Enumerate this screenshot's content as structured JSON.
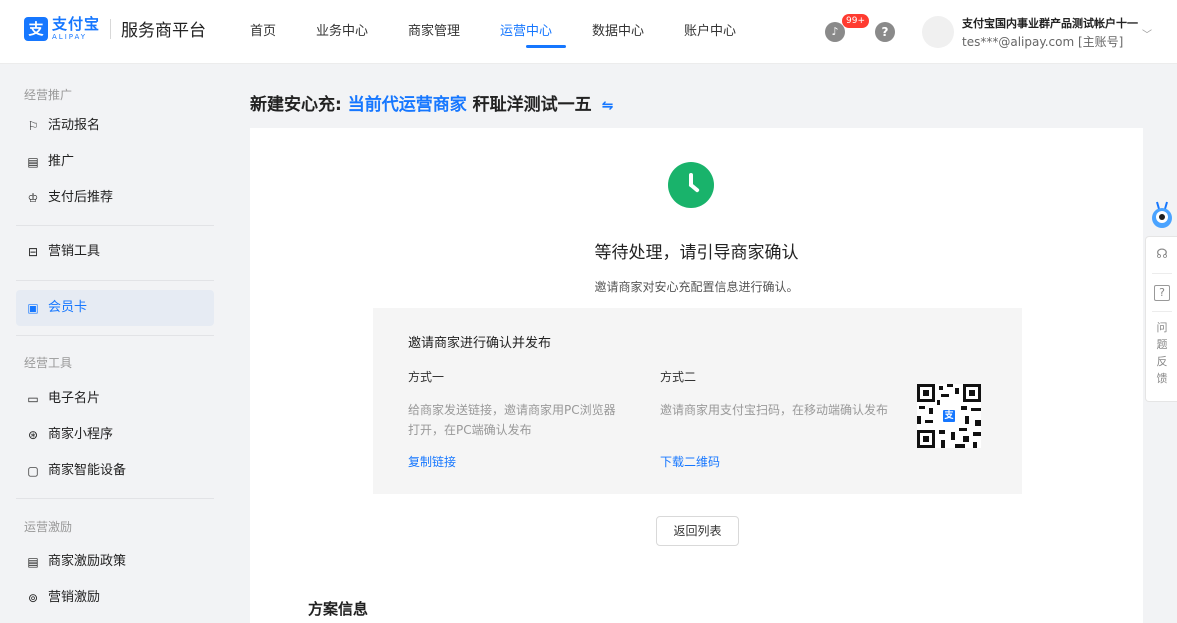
{
  "brand": {
    "logo_mark": "支",
    "name_cn": "支付宝",
    "name_en": "ALIPAY",
    "platform": "服务商平台"
  },
  "nav": [
    {
      "label": "首页",
      "active": false
    },
    {
      "label": "业务中心",
      "active": false
    },
    {
      "label": "商家管理",
      "active": false
    },
    {
      "label": "运营中心",
      "active": true
    },
    {
      "label": "数据中心",
      "active": false
    },
    {
      "label": "账户中心",
      "active": false
    }
  ],
  "header": {
    "notification_badge": "99+",
    "help_icon": "?",
    "account_name": "支付宝国内事业群产品测试帐户十一",
    "account_email": "tes***@alipay.com [主账号]"
  },
  "sidebar": {
    "groups": [
      {
        "label": "经营推广",
        "items": [
          {
            "label": "活动报名",
            "icon": "flag-icon",
            "glyph": "⚐"
          },
          {
            "label": "推广",
            "icon": "list-icon",
            "glyph": "▤"
          },
          {
            "label": "支付后推荐",
            "icon": "crown-icon",
            "glyph": "♔"
          }
        ]
      },
      {
        "label": "",
        "items": [
          {
            "label": "营销工具",
            "icon": "toolbox-icon",
            "glyph": "⊟"
          }
        ]
      },
      {
        "label": "",
        "items": [
          {
            "label": "会员卡",
            "icon": "card-icon",
            "glyph": "▣",
            "active": true
          }
        ]
      },
      {
        "label": "经营工具",
        "items": [
          {
            "label": "电子名片",
            "icon": "id-card-icon",
            "glyph": "▭"
          },
          {
            "label": "商家小程序",
            "icon": "miniapp-icon",
            "glyph": "⊛"
          },
          {
            "label": "商家智能设备",
            "icon": "device-icon",
            "glyph": "▢"
          }
        ]
      },
      {
        "label": "运营激励",
        "items": [
          {
            "label": "商家激励政策",
            "icon": "policy-icon",
            "glyph": "▤"
          },
          {
            "label": "营销激励",
            "icon": "reward-icon",
            "glyph": "⊚"
          }
        ]
      }
    ]
  },
  "page": {
    "title_prefix": "新建安心充:",
    "title_highlight": "当前代运营商家",
    "title_merchant": "秆耻洋测试一五",
    "swap_icon": "⇋"
  },
  "status": {
    "title": "等待处理，请引导商家确认",
    "desc": "邀请商家对安心充配置信息进行确认。"
  },
  "invite": {
    "title": "邀请商家进行确认并发布",
    "method1": {
      "title": "方式一",
      "desc": "给商家发送链接，邀请商家用PC浏览器打开，在PC端确认发布",
      "link": "复制链接"
    },
    "method2": {
      "title": "方式二",
      "desc": "邀请商家用支付宝扫码，在移动端确认发布",
      "link": "下载二维码"
    }
  },
  "back_button": "返回列表",
  "plan_section_title": "方案信息",
  "float_bar": {
    "feedback_chars": [
      "问",
      "题",
      "反",
      "馈"
    ],
    "help_glyph": "?"
  },
  "colors": {
    "accent": "#1677ff",
    "success": "#19b36b",
    "badge": "#ff3b30"
  }
}
